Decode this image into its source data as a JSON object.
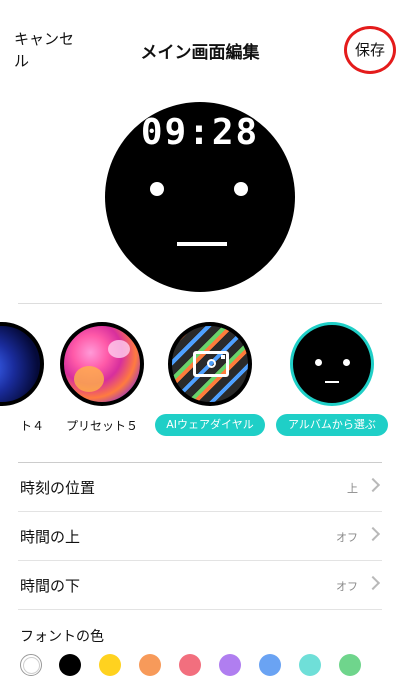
{
  "header": {
    "cancel_line1": "キャンセ",
    "cancel_line2": "ル",
    "title": "メイン画面編集",
    "save_label": "保存"
  },
  "preview": {
    "time": "09:28"
  },
  "presets": [
    {
      "label": "ト４",
      "kind": "partial-blue"
    },
    {
      "label": "プリセット５",
      "kind": "pink-swirl"
    },
    {
      "label": "AIウェアダイヤル",
      "kind": "camera",
      "pill": true
    },
    {
      "label": "アルバムから選ぶ",
      "kind": "face",
      "pill": true,
      "selected": true
    }
  ],
  "settings": [
    {
      "label": "時刻の位置",
      "value": "上"
    },
    {
      "label": "時間の上",
      "value": "オフ"
    },
    {
      "label": "時間の下",
      "value": "オフ"
    }
  ],
  "font_color": {
    "label": "フォントの色",
    "colors": [
      "#ffffff",
      "#000000",
      "#ffd21f",
      "#f79a5a",
      "#f26f7e",
      "#b07ef0",
      "#6aa3f3",
      "#6fdfd8",
      "#6fd58c"
    ]
  },
  "accent": "#1fcfc7",
  "highlight": "#e41b1b"
}
